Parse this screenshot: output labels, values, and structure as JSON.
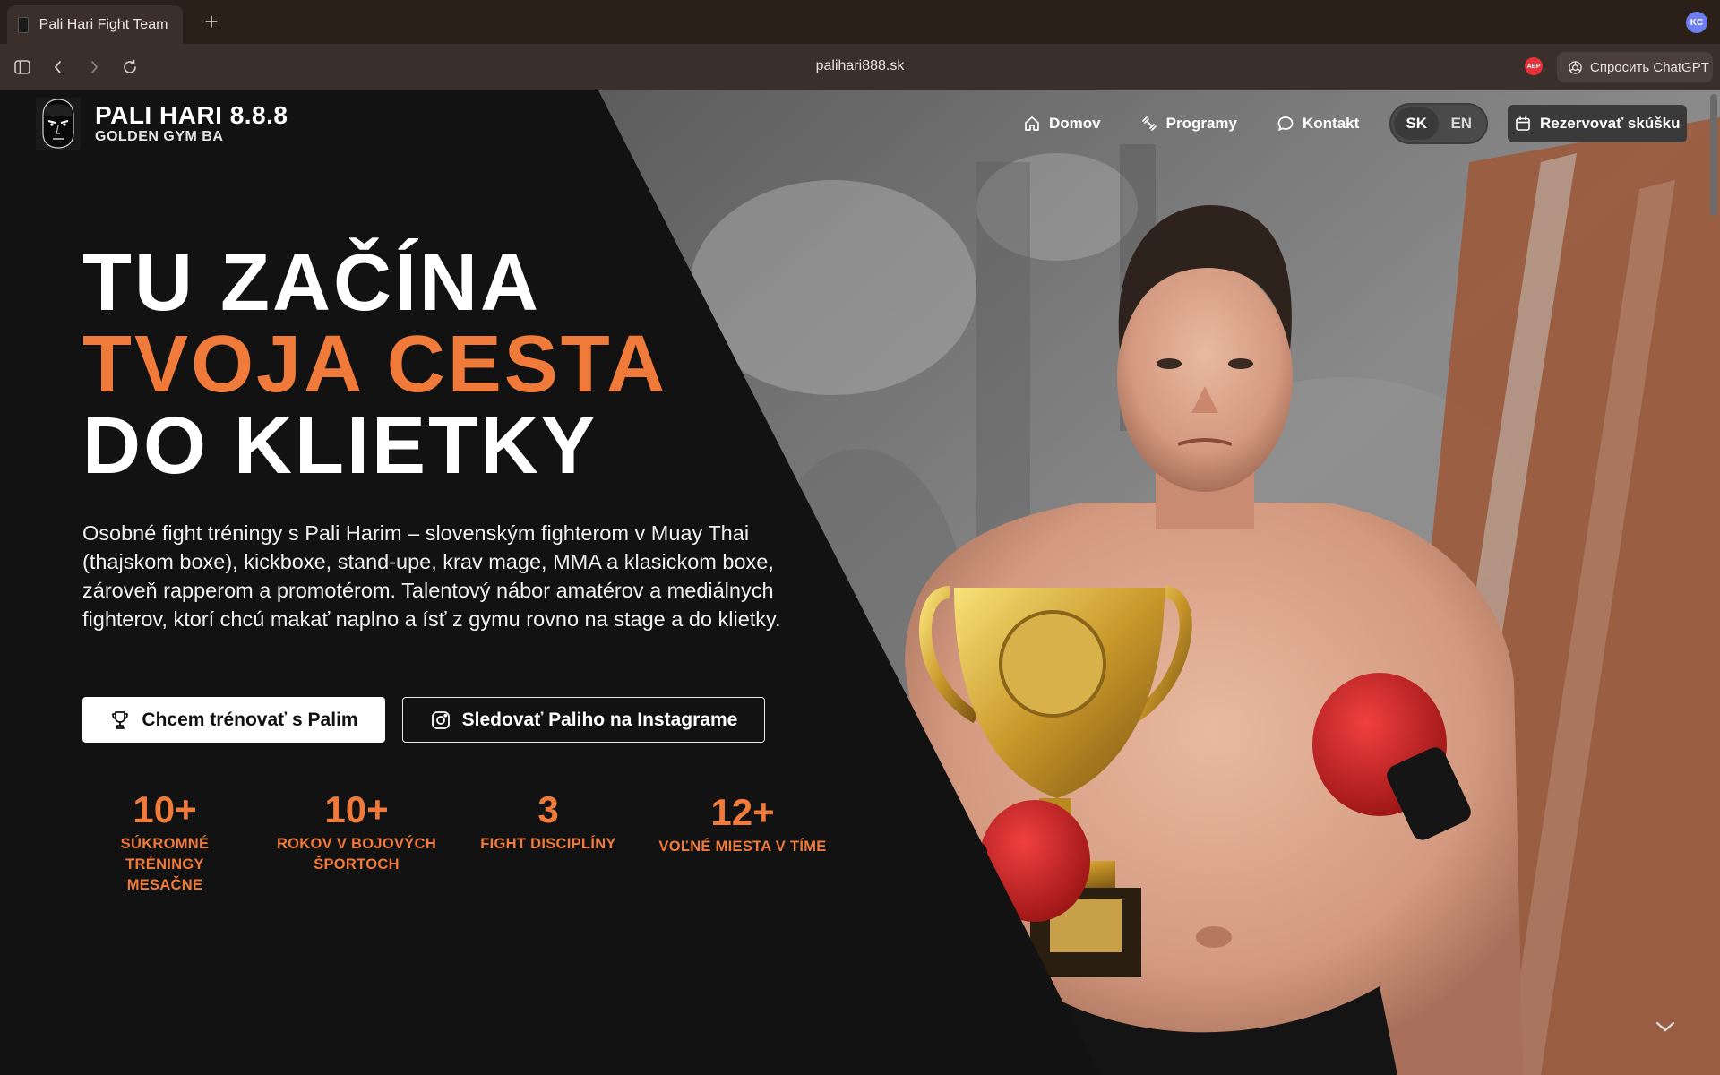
{
  "browser": {
    "tab_title": "Pali Hari Fight Team -",
    "new_tab": "+",
    "profile_initials": "KC",
    "url": "palihari888.sk",
    "extension_badge": "ABP",
    "chatgpt_button": "Спросить ChatGPT"
  },
  "header": {
    "logo_title": "PALI HARI 8.8.8",
    "logo_subtitle": "GOLDEN GYM BA",
    "nav": {
      "home": "Domov",
      "programs": "Programy",
      "contact": "Kontakt"
    },
    "languages": [
      "SK",
      "EN"
    ],
    "active_language": "SK",
    "book_button": "Rezervovať skúšku"
  },
  "hero": {
    "line1": "TU ZAČÍNA",
    "line2": "TVOJA CESTA",
    "line3": "DO KLIETKY",
    "intro": "Osobné fight tréningy s Pali Harim – slovenským fighterom v Muay Thai (thajskom boxe), kickboxe, stand-upe, krav mage, MMA a klasickom boxe, zároveň rapperom a promotérom. Talentový nábor amatérov a mediálnych fighterov, ktorí chcú makať naplno a ísť z gymu rovno na stage a do klietky.",
    "cta_primary": "Chcem trénovať s Palim",
    "cta_secondary": "Sledovať Paliho na Instagrame",
    "accent_color": "#f07a3a"
  },
  "stats": [
    {
      "value": "10+",
      "label_line1": "SÚKROMNÉ TRÉNINGY",
      "label_line2": "MESAČNE"
    },
    {
      "value": "10+",
      "label_line1": "ROKOV V BOJOVÝCH",
      "label_line2": "ŠPORTOCH"
    },
    {
      "value": "3",
      "label_line1": "FIGHT DISCIPLÍNY",
      "label_line2": ""
    },
    {
      "value": "12+",
      "label_line1": "VOĽNÉ MIESTA V TÍME",
      "label_line2": ""
    }
  ]
}
